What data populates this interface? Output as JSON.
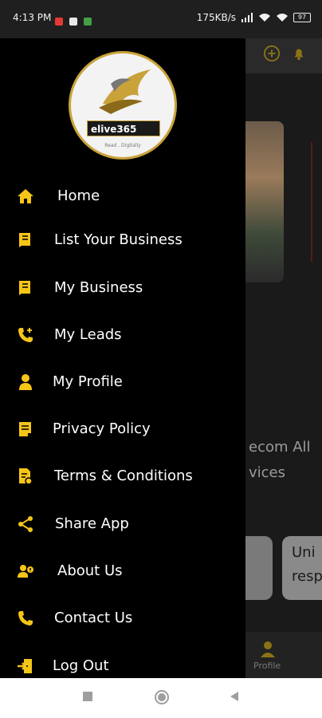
{
  "status_bar": {
    "time": "4:13 PM",
    "network_speed": "175KB/s",
    "battery": "97"
  },
  "drawer": {
    "logo_brand": "elive365",
    "logo_tagline": "Read . Digitally",
    "items": [
      {
        "label": "Home",
        "icon": "home-icon"
      },
      {
        "label": "List Your Business",
        "icon": "book-icon"
      },
      {
        "label": "My Business",
        "icon": "book-icon"
      },
      {
        "label": "My Leads",
        "icon": "phone-plus-icon"
      },
      {
        "label": "My Profile",
        "icon": "person-icon"
      },
      {
        "label": "Privacy Policy",
        "icon": "document-icon"
      },
      {
        "label": "Terms & Conditions",
        "icon": "terms-document-icon"
      },
      {
        "label": "Share App",
        "icon": "share-icon"
      },
      {
        "label": "About Us",
        "icon": "people-info-icon"
      },
      {
        "label": "Contact Us",
        "icon": "phone-icon"
      },
      {
        "label": "Log Out",
        "icon": "logout-icon"
      }
    ]
  },
  "background_app": {
    "text_line1": "ecom All",
    "text_line2": "vices",
    "card_line1": "Uni",
    "card_line2": "resp",
    "bottom_nav_label": "Profile"
  },
  "colors": {
    "accent": "#F5C518",
    "drawer_bg": "#000000",
    "text": "#FFFFFF"
  }
}
